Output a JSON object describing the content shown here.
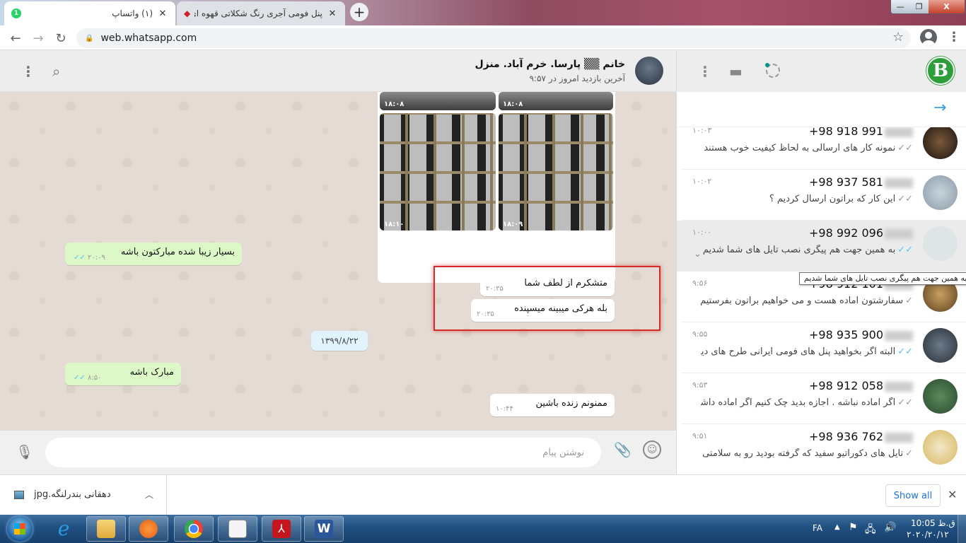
{
  "browser": {
    "tabs": [
      {
        "label": "(۱) واتساپ",
        "badge": "1",
        "active": true
      },
      {
        "label": "پنل فومی آجری رنگ شکلاتی قهوه ای - فرو",
        "active": false
      }
    ],
    "new_tab_label": "+",
    "url": "web.whatsapp.com",
    "window_controls": {
      "minimize": "—",
      "maximize": "❐",
      "close": "X"
    }
  },
  "chat": {
    "contact_name": "خانم ▒▒ پارسا. خرم آباد. منزل",
    "contact_status": "آخرین بازدید امروز در ۹:۵۷",
    "images": [
      {
        "time": "۱۸:۰۸"
      },
      {
        "time": "۱۸:۰۸"
      },
      {
        "time": "۱۸:۱۰"
      },
      {
        "time": "۱۸:۰۹"
      }
    ],
    "messages": [
      {
        "direction": "in",
        "text": "بسیار زیبا شده مبارکتون باشه",
        "time": "۲۰:۰۹",
        "ticks": "✓✓"
      },
      {
        "direction": "out",
        "text": "متشکرم از لطف شما",
        "time": "۲۰:۳۵"
      },
      {
        "direction": "out",
        "text": "بله هرکی میبینه میسپنده",
        "time": "۲۰:۳۵"
      },
      {
        "direction": "in",
        "text": "مبارک باشه",
        "time": "۸:۵۰",
        "ticks": "✓✓"
      },
      {
        "direction": "out",
        "text": "ممنونم زنده باشین",
        "time": "۱۰:۴۴"
      }
    ],
    "date_separator": "۱۳۹۹/۸/۲۲",
    "composer_placeholder": "نوشتن پیام",
    "highlight_color": "#d42a2a"
  },
  "sidebar": {
    "my_avatar_letter": "B",
    "chats": [
      {
        "phone": "+98 918 991",
        "time": "۱۰:۰۳",
        "preview": "نمونه کار های ارسالی به لحاظ کیفیت خوب هستند ما امکان ...",
        "ticks": "✓✓",
        "read": false
      },
      {
        "phone": "+98 937 581",
        "time": "۱۰:۰۲",
        "preview": "این کار که براتون ارسال کردیم ؟",
        "ticks": "✓✓",
        "read": false
      },
      {
        "phone": "+98 992 096",
        "time": "۱۰:۰۰",
        "preview": "به همین جهت هم پیگری نصب تایل های شما شدیم",
        "ticks": "✓✓",
        "read": true,
        "active": true
      },
      {
        "phone": "+98 912 101",
        "time": "۹:۵۶",
        "preview": "سفارشتون آماده هست و می خواهیم براتون بفرستیم",
        "ticks": "✓",
        "read": false
      },
      {
        "phone": "+98 935 900",
        "time": "۹:۵۵",
        "preview": "البته اگر بخواهید پنل های فومی ایرانی طرح های دیگه ای ه..",
        "ticks": "✓✓",
        "read": true
      },
      {
        "phone": "+98 912 058",
        "time": "۹:۵۳",
        "preview": "اگر آماده نباشه . اجازه بدید چک کنیم اگر آماده داشته باشیم ی..",
        "ticks": "✓✓",
        "read": false
      },
      {
        "phone": "+98 936 762",
        "time": "۹:۵۱",
        "preview": "تایل های دکوراتیو سفید که گرفته بودید رو به سلامتی نصب ...",
        "ticks": "✓",
        "read": false
      }
    ],
    "tooltip": "به همین جهت هم پیگری نصب تایل های شما شدیم"
  },
  "downloads": {
    "file_name": "دهقانی بندرلنگه.jpg",
    "show_all": "Show all"
  },
  "taskbar": {
    "language": "FA",
    "time": "ق.ظ 10:05",
    "date": "۲۰۲۰/۲۰/۱۲"
  }
}
